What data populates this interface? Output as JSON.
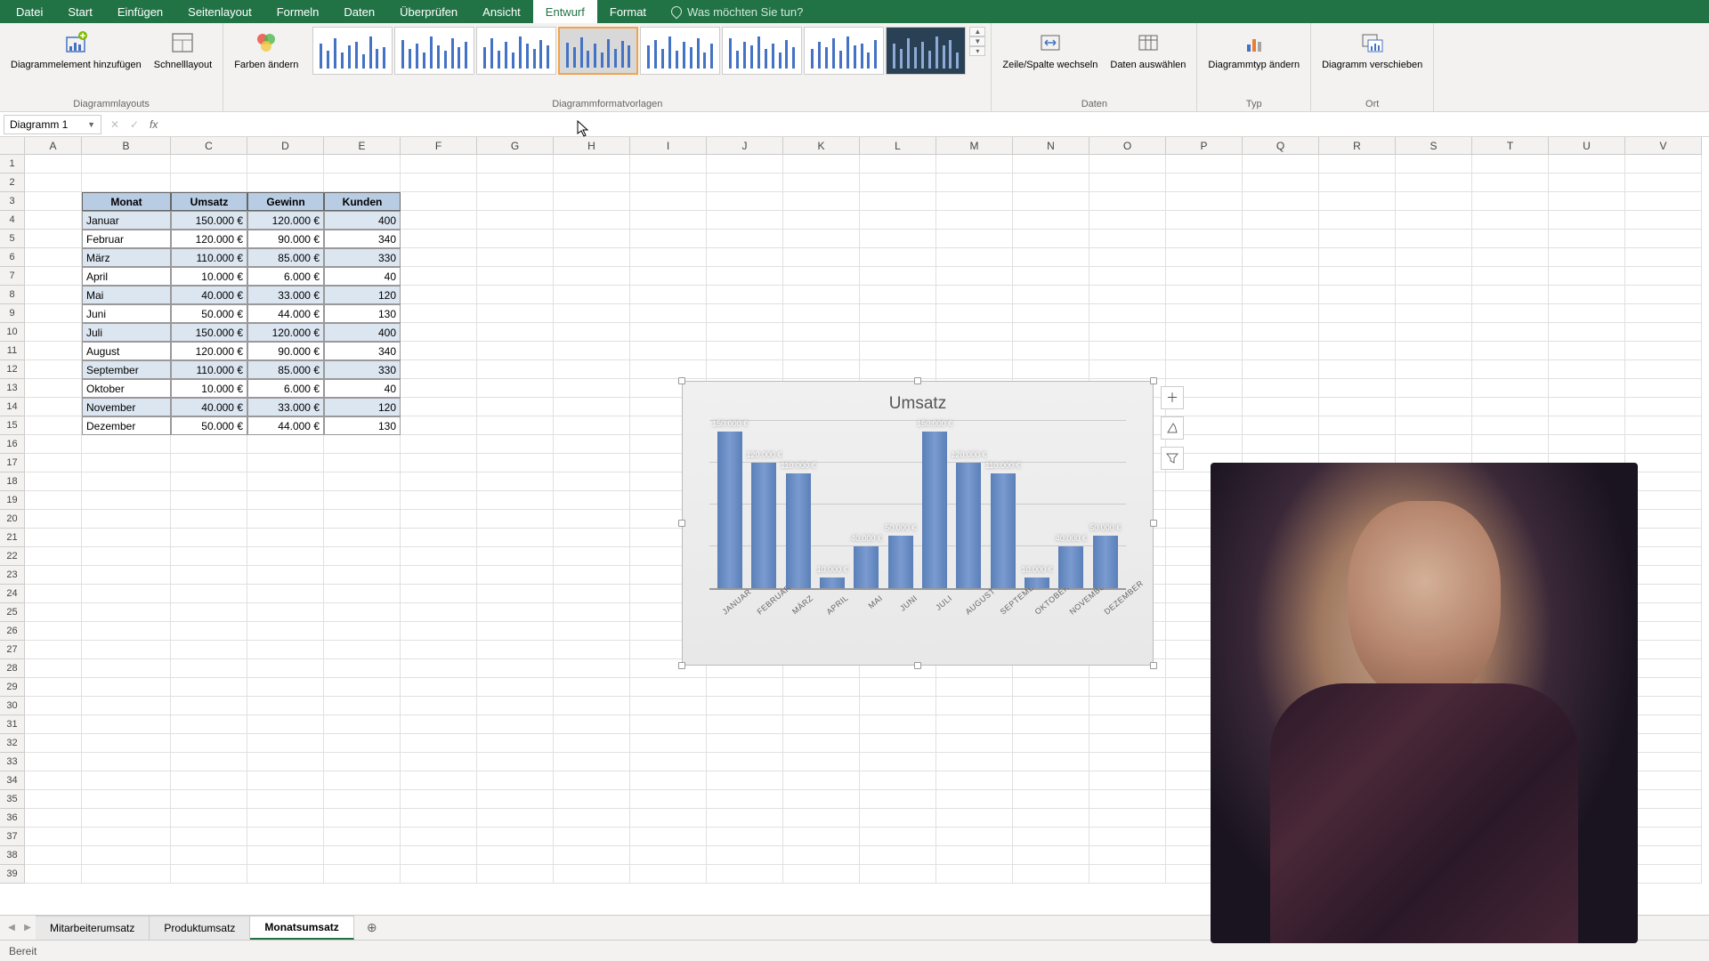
{
  "tabs": [
    "Datei",
    "Start",
    "Einfügen",
    "Seitenlayout",
    "Formeln",
    "Daten",
    "Überprüfen",
    "Ansicht",
    "Entwurf",
    "Format"
  ],
  "active_tab": 8,
  "tell_me": "Was möchten Sie tun?",
  "ribbon": {
    "layouts": {
      "add_element": "Diagrammelement hinzufügen",
      "quick_layout": "Schnelllayout",
      "group": "Diagrammlayouts"
    },
    "colors": "Farben ändern",
    "styles_group": "Diagrammformatvorlagen",
    "data": {
      "switch": "Zeile/Spalte wechseln",
      "select": "Daten auswählen",
      "group": "Daten"
    },
    "type": {
      "change": "Diagrammtyp ändern",
      "group": "Typ"
    },
    "location": {
      "move": "Diagramm verschieben",
      "group": "Ort"
    }
  },
  "namebox": "Diagramm 1",
  "columns": [
    "A",
    "B",
    "C",
    "D",
    "E",
    "F",
    "G",
    "H",
    "I",
    "J",
    "K",
    "L",
    "M",
    "N",
    "O",
    "P",
    "Q",
    "R",
    "S",
    "T",
    "U",
    "V"
  ],
  "table": {
    "headers": [
      "Monat",
      "Umsatz",
      "Gewinn",
      "Kunden"
    ],
    "rows": [
      [
        "Januar",
        "150.000 €",
        "120.000 €",
        "400"
      ],
      [
        "Februar",
        "120.000 €",
        "90.000 €",
        "340"
      ],
      [
        "März",
        "110.000 €",
        "85.000 €",
        "330"
      ],
      [
        "April",
        "10.000 €",
        "6.000 €",
        "40"
      ],
      [
        "Mai",
        "40.000 €",
        "33.000 €",
        "120"
      ],
      [
        "Juni",
        "50.000 €",
        "44.000 €",
        "130"
      ],
      [
        "Juli",
        "150.000 €",
        "120.000 €",
        "400"
      ],
      [
        "August",
        "120.000 €",
        "90.000 €",
        "340"
      ],
      [
        "September",
        "110.000 €",
        "85.000 €",
        "330"
      ],
      [
        "Oktober",
        "10.000 €",
        "6.000 €",
        "40"
      ],
      [
        "November",
        "40.000 €",
        "33.000 €",
        "120"
      ],
      [
        "Dezember",
        "50.000 €",
        "44.000 €",
        "130"
      ]
    ]
  },
  "chart_data": {
    "type": "bar",
    "title": "Umsatz",
    "categories": [
      "JANUAR",
      "FEBRUAR",
      "MÄRZ",
      "APRIL",
      "MAI",
      "JUNI",
      "JULI",
      "AUGUST",
      "SEPTEMBER",
      "OKTOBER",
      "NOVEMBER",
      "DEZEMBER"
    ],
    "values": [
      150000,
      120000,
      110000,
      10000,
      40000,
      50000,
      150000,
      120000,
      110000,
      10000,
      40000,
      50000
    ],
    "value_labels": [
      "150.000 €",
      "120.000 €",
      "110.000 €",
      "10.000 €",
      "40.000 €",
      "50.000 €",
      "150.000 €",
      "120.000 €",
      "110.000 €",
      "10.000 €",
      "40.000 €",
      "50.000 €"
    ],
    "ylim": [
      0,
      160000
    ]
  },
  "sheets": [
    "Mitarbeiterumsatz",
    "Produktumsatz",
    "Monatsumsatz"
  ],
  "active_sheet": 2,
  "status": "Bereit"
}
